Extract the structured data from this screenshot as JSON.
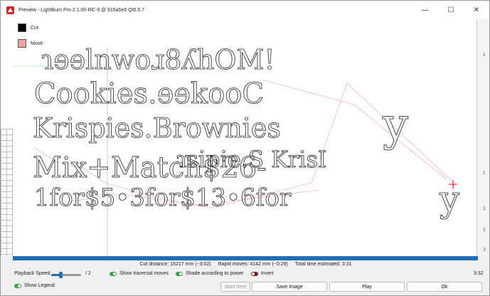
{
  "window": {
    "title": "Preview - LightBurn Pro 2.1.00-RC-9 @ 915a5e5 Qt6.5.7",
    "min_glyph": "—",
    "max_glyph": "☐",
    "close_glyph": "✕"
  },
  "legend": {
    "items": [
      {
        "label": "Cut",
        "color": "#000000"
      },
      {
        "label": "Move",
        "color": "#f4a3a3"
      }
    ]
  },
  "preview": {
    "lines": [
      {
        "text": "ɿɘɘlnwoɹ8ʎhOM!"
      },
      {
        "text": "Cookies.ɘɘkooC"
      },
      {
        "text": "Krispies.Brownies"
      },
      {
        "text": "ɿsipie.S KrisI"
      },
      {
        "text": "Mix+Match$26-"
      },
      {
        "text": "1for$5•3for$13•6for"
      }
    ],
    "glyph_large": "y",
    "glyph_small": "y"
  },
  "ruler": {
    "ticks": [
      "1",
      "1",
      "2",
      "2",
      "3"
    ]
  },
  "playback": {
    "progress": 1.0
  },
  "stats": {
    "cut_distance": "Cut distance: 15217 mm (~3:02)",
    "rapid_moves": "Rapid moves: 4142 mm (~0:29)",
    "total_time": "Total time estimated: 3:31"
  },
  "controls": {
    "playback_speed_label": "Playback Speed",
    "speed_value": "/ 2",
    "speed_fraction": 0.3,
    "show_traversal": {
      "label": "Show traversal moves",
      "on": true
    },
    "shade_power": {
      "label": "Shade according to power",
      "on": true
    },
    "invert": {
      "label": "Invert",
      "on": false
    },
    "time_readout": "3:32"
  },
  "bottom": {
    "show_legend": {
      "label": "Show Legend",
      "on": true
    },
    "start_here": "Start here",
    "save_image": "Save Image",
    "play": "Play",
    "ok": "Ok"
  }
}
